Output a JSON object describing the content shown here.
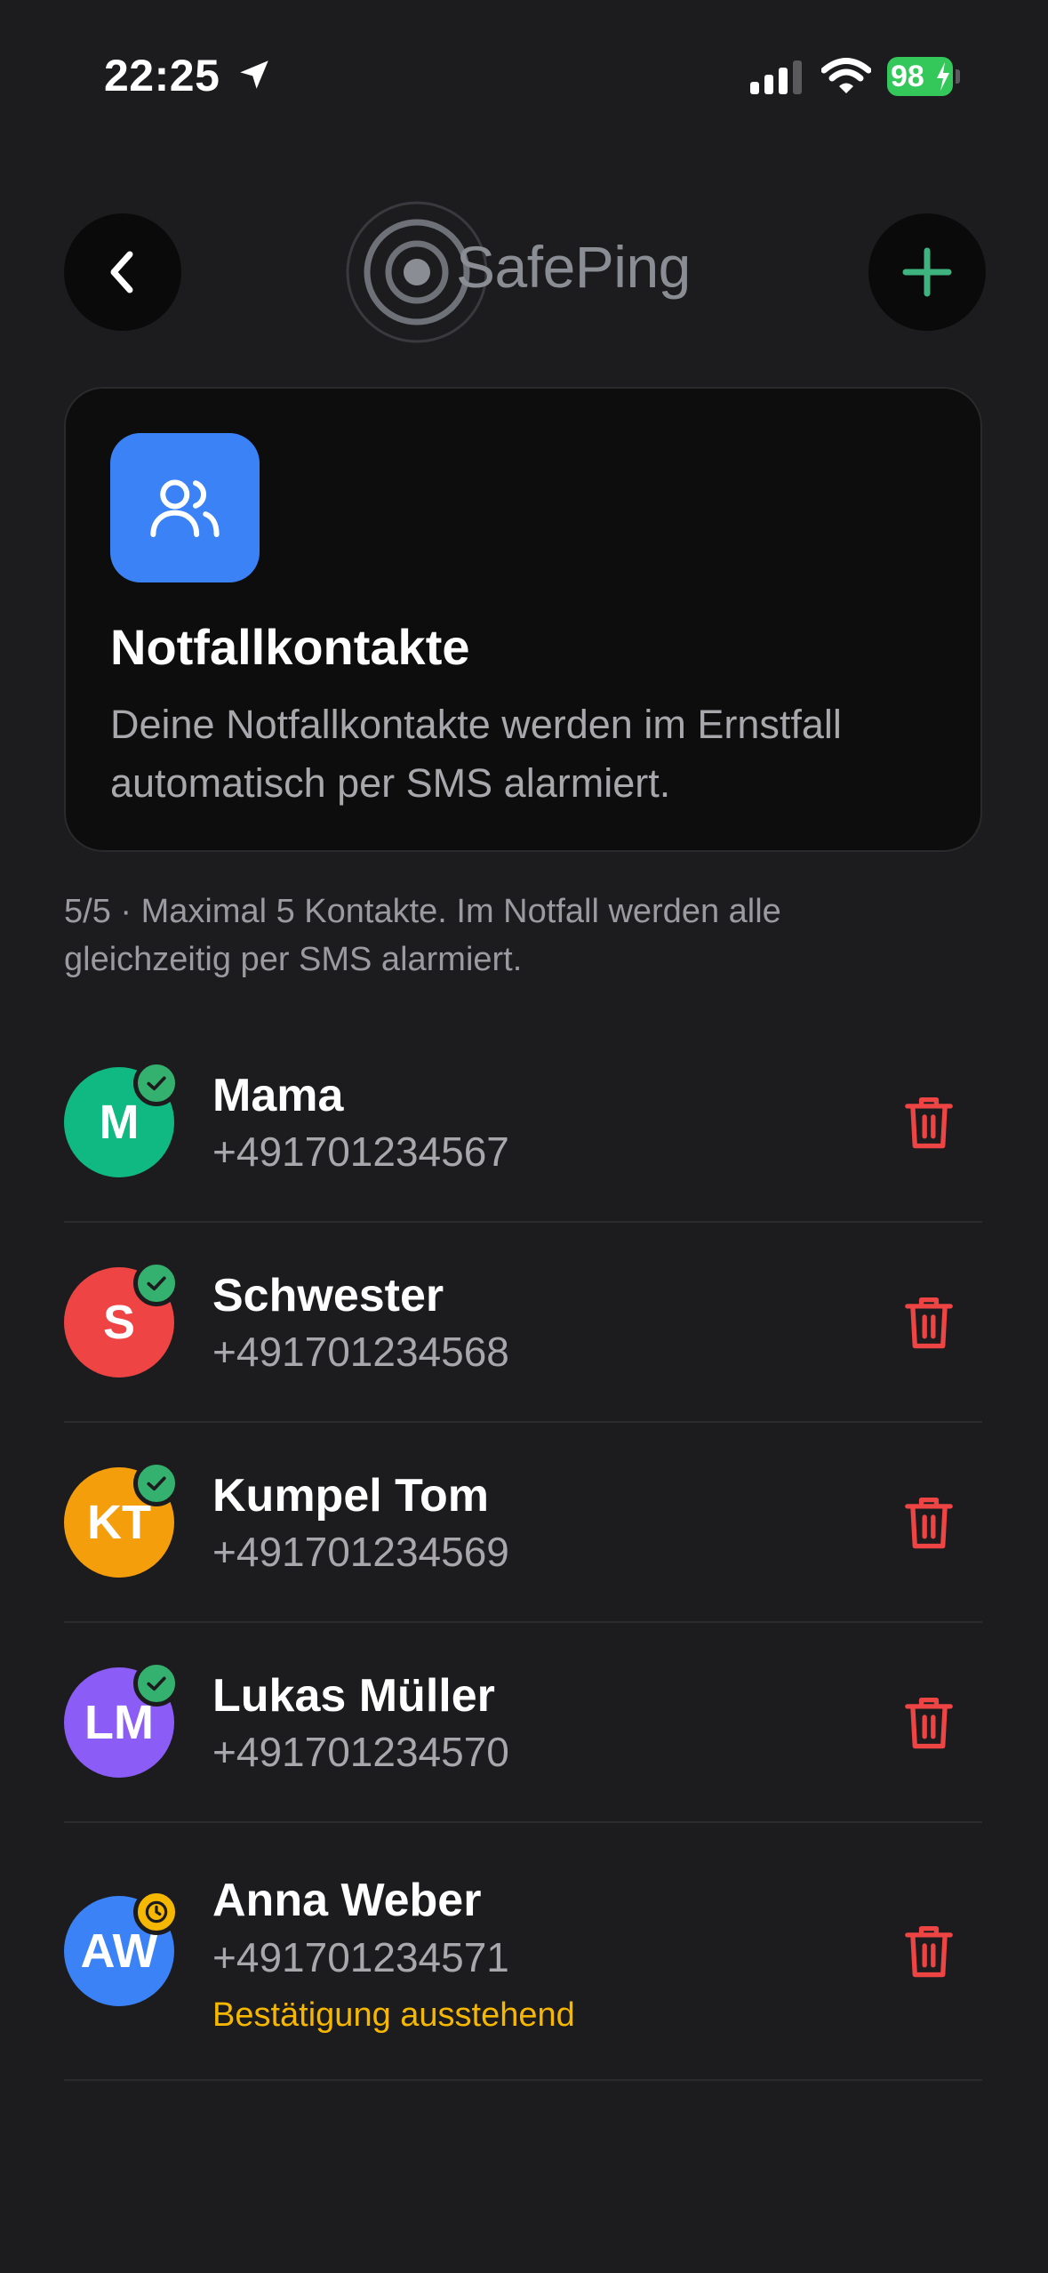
{
  "status_bar": {
    "time": "22:25",
    "battery_level": "98"
  },
  "header": {
    "back_icon": "chevron-left-icon",
    "logo_text": "SafePing",
    "add_icon": "plus-icon",
    "accent_color": "#3fb37f"
  },
  "card": {
    "icon": "users-icon",
    "title": "Notfallkontakte",
    "description": "Deine Notfallkontakte werden im Ernstfall automatisch per SMS alarmiert."
  },
  "hint": "5/5 · Maximal 5 Kontakte. Im Notfall werden alle gleichzeitig per SMS alarmiert.",
  "contacts": [
    {
      "initials": "M",
      "name": "Mama",
      "phone": "+491701234567",
      "color": "#10b981",
      "status": "confirmed"
    },
    {
      "initials": "S",
      "name": "Schwester",
      "phone": "+491701234568",
      "color": "#ef4444",
      "status": "confirmed"
    },
    {
      "initials": "KT",
      "name": "Kumpel Tom",
      "phone": "+491701234569",
      "color": "#f59e0b",
      "status": "confirmed"
    },
    {
      "initials": "LM",
      "name": "Lukas Müller",
      "phone": "+491701234570",
      "color": "#8b5cf6",
      "status": "confirmed"
    },
    {
      "initials": "AW",
      "name": "Anna Weber",
      "phone": "+491701234571",
      "color": "#3b82f6",
      "status": "pending",
      "status_label": "Bestätigung ausstehend"
    }
  ],
  "colors": {
    "delete": "#ef4444",
    "confirmed": "#34b16f",
    "pending": "#f5b700"
  }
}
